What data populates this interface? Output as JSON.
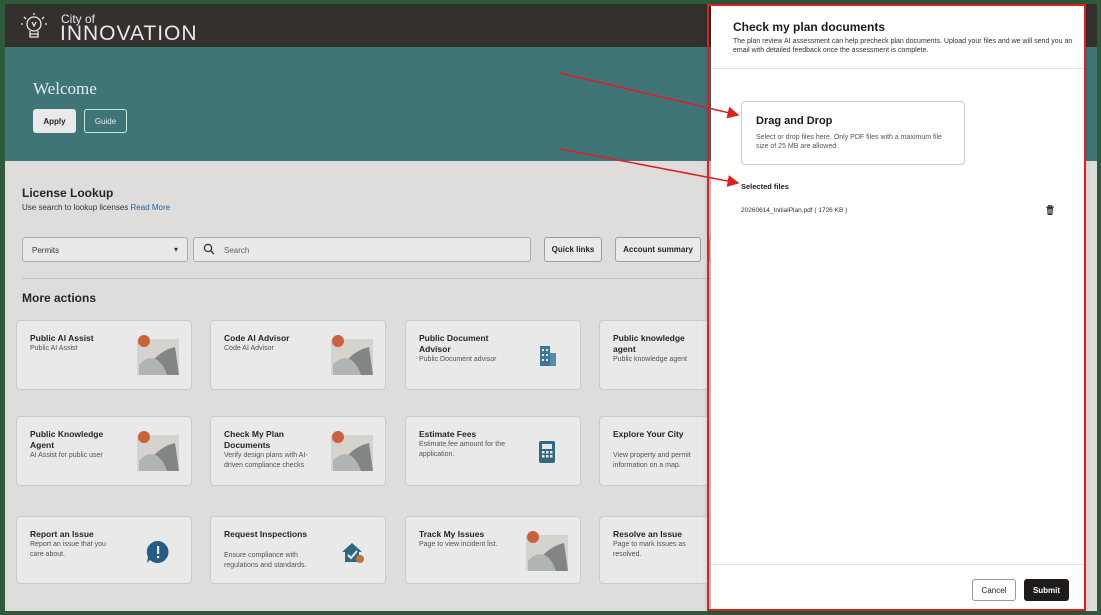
{
  "brand": {
    "line1": "City of",
    "line2": "INNOVATION"
  },
  "hero": {
    "title": "Welcome",
    "apply_label": "Apply",
    "guide_label": "Guide"
  },
  "lookup": {
    "title": "License Lookup",
    "subtitle": "Use search to lookup licenses",
    "read_more": "Read More",
    "select_value": "Permits",
    "search_placeholder": "Search",
    "quick_links": "Quick links",
    "account_summary": "Account summary"
  },
  "more_actions": {
    "title": "More actions",
    "cards": [
      {
        "title": "Public AI Assist",
        "desc": "Public AI Assist",
        "icon": "image-placeholder-icon"
      },
      {
        "title": "Code AI Advisor",
        "desc": "Code AI Advisor",
        "icon": "image-placeholder-icon"
      },
      {
        "title": "Public Document Advisor",
        "desc": "Public Document advisor",
        "icon": "building-icon"
      },
      {
        "title": "Public knowledge agent",
        "desc": "Public knowledge agent",
        "icon": "none"
      },
      {
        "title": "Public Knowledge Agent",
        "desc": "AI Assist for public user",
        "icon": "image-placeholder-icon"
      },
      {
        "title": "Check My Plan Documents",
        "desc": "Verify design plans with AI-driven compliance checks",
        "icon": "image-placeholder-icon"
      },
      {
        "title": "Estimate Fees",
        "desc": "Estimate fee amount for the application.",
        "icon": "calculator-icon"
      },
      {
        "title": "Explore Your City",
        "desc": "View property and permit information on a map.",
        "icon": "none"
      },
      {
        "title": "Report an Issue",
        "desc": "Report an issue that you care about.",
        "icon": "alert-bubble-icon"
      },
      {
        "title": "Request Inspections",
        "desc": "Ensure compliance with regulations and standards.",
        "icon": "house-check-icon"
      },
      {
        "title": "Track My Issues",
        "desc": "Page to view incident list.",
        "icon": "image-placeholder-icon"
      },
      {
        "title": "Resolve an Issue",
        "desc": "Page to mark issues as resolved.",
        "icon": "none"
      }
    ]
  },
  "drawer": {
    "title": "Check my plan documents",
    "subtitle": "The plan review AI assessment can help precheck plan documents. Upload your files and we will send you an email with detailed feedback once the assessment is complete.",
    "dropzone_title": "Drag and Drop",
    "dropzone_desc": "Select or drop files here. Only PDF files with a maximum file size of 25 MB are allowed.",
    "selected_label": "Selected files",
    "file_entry": "20260614_InitialPlan.pdf ( 1726 KB )",
    "cancel_label": "Cancel",
    "submit_label": "Submit"
  },
  "colors": {
    "hero": "#3f7c7f",
    "topbar": "#312d2a",
    "annotation": "#e02020",
    "submit": "#1e1b19"
  }
}
